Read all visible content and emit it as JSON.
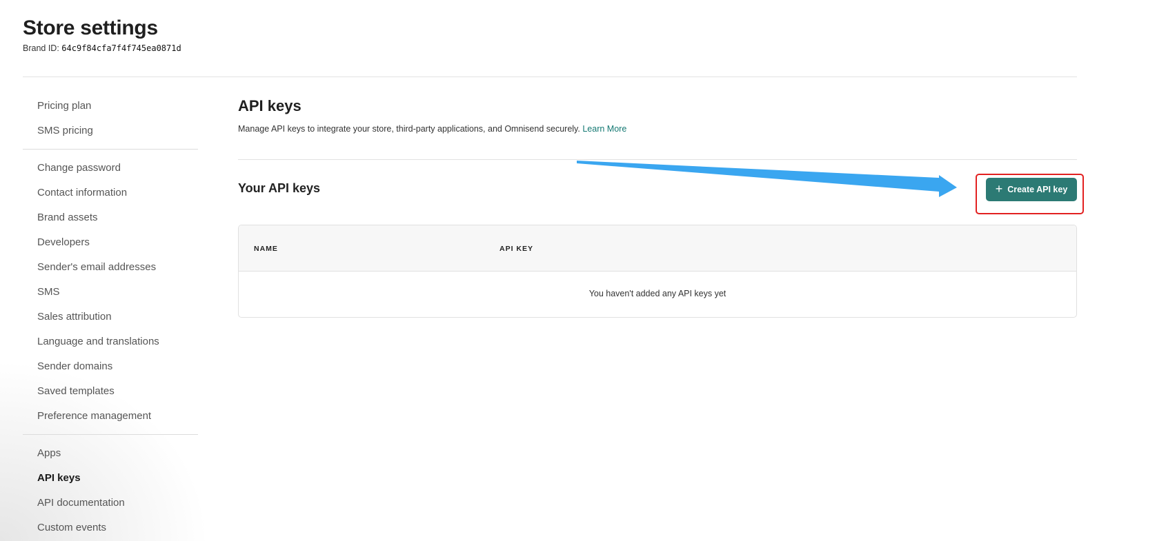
{
  "header": {
    "title": "Store settings",
    "brand_label": "Brand ID:",
    "brand_id": "64c9f84cfa7f4f745ea0871d"
  },
  "sidebar": {
    "groups": [
      [
        "Pricing plan",
        "SMS pricing"
      ],
      [
        "Change password",
        "Contact information",
        "Brand assets",
        "Developers",
        "Sender's email addresses",
        "SMS",
        "Sales attribution",
        "Language and translations",
        "Sender domains",
        "Saved templates",
        "Preference management"
      ],
      [
        "Apps",
        "API keys",
        "API documentation",
        "Custom events"
      ]
    ],
    "active": "API keys"
  },
  "main": {
    "title": "API keys",
    "description": "Manage API keys to integrate your store, third-party applications, and Omnisend securely.",
    "learn_more": "Learn More",
    "subtitle": "Your API keys",
    "create_button": "Create API key",
    "create_icon": "plus-icon"
  },
  "table": {
    "columns": [
      "NAME",
      "API KEY"
    ],
    "empty_message": "You haven't added any API keys yet"
  },
  "annotations": {
    "arrow_color": "#3aa6f0",
    "highlight_color": "#e22020"
  },
  "colors": {
    "accent": "#2c7a74",
    "link": "#137872"
  }
}
